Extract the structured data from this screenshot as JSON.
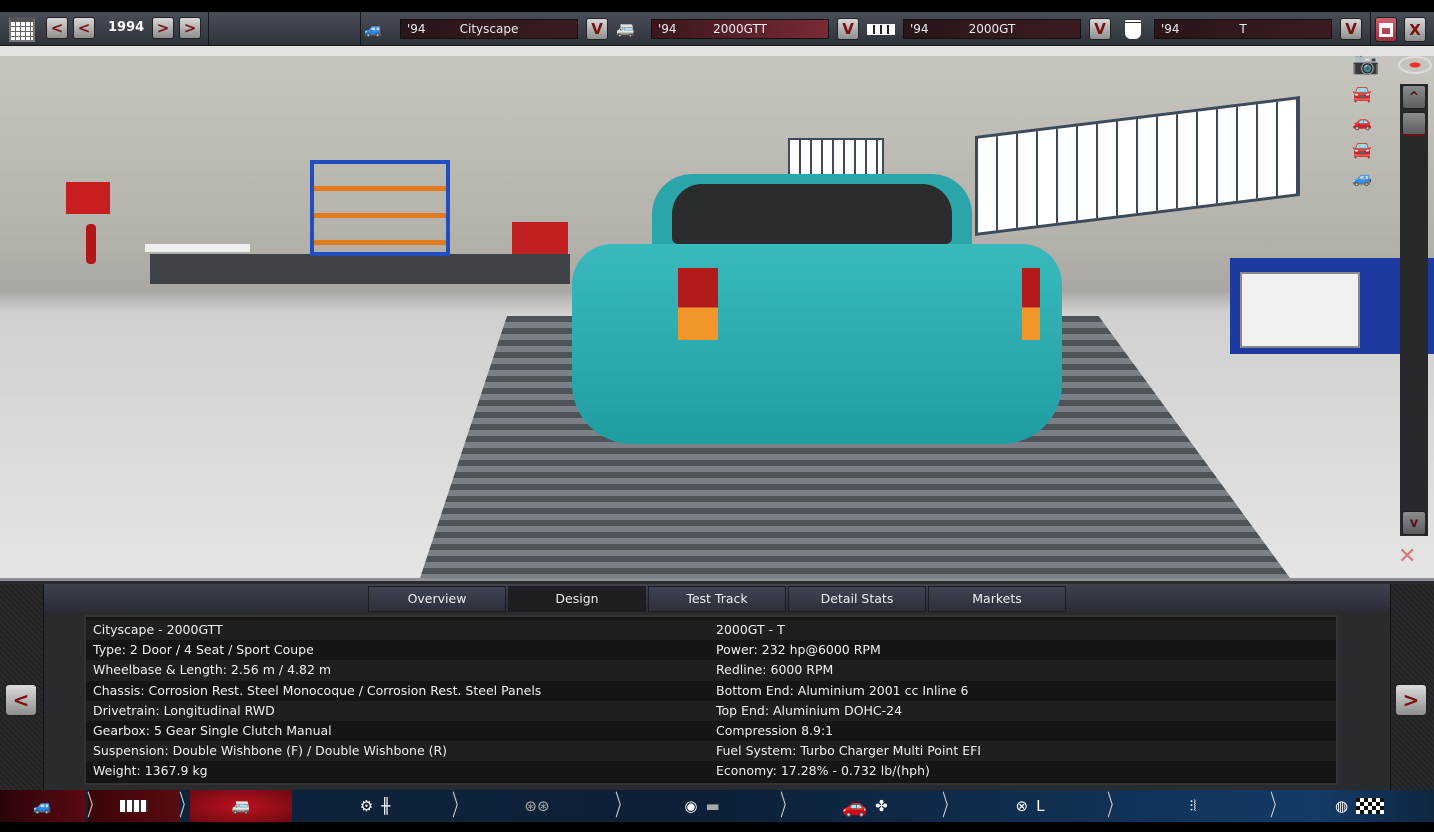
{
  "toolbar": {
    "year": "1994",
    "prev_label": "<",
    "next_label": ">",
    "selectors": [
      {
        "icon": "car-body-icon",
        "year": "'94",
        "name": "Cityscape",
        "dropdown": "V"
      },
      {
        "icon": "car-model-icon",
        "year": "'94",
        "name": "2000GTT",
        "dropdown": "V"
      },
      {
        "icon": "engine-block-icon",
        "year": "'94",
        "name": "2000GT",
        "dropdown": "V"
      },
      {
        "icon": "piston-icon",
        "year": "'94",
        "name": "T",
        "dropdown": "V"
      }
    ],
    "save_icon": "save-icon",
    "close_label": "X"
  },
  "viewport": {
    "scroll_up": "^",
    "scroll_down": "v"
  },
  "tabs": [
    "Overview",
    "Design",
    "Test Track",
    "Detail Stats",
    "Markets"
  ],
  "active_tab": "Design",
  "info": {
    "left": [
      "Cityscape - 2000GTT",
      "Type: 2 Door / 4 Seat / Sport Coupe",
      "Wheelbase & Length: 2.56 m / 4.82 m",
      "Chassis: Corrosion Rest. Steel Monocoque / Corrosion Rest. Steel Panels",
      "Drivetrain: Longitudinal RWD",
      "Gearbox: 5 Gear Single Clutch Manual",
      "Suspension: Double Wishbone (F) / Double Wishbone (R)",
      "Weight: 1367.9 kg"
    ],
    "right": [
      "2000GT - T",
      "Power: 232 hp@6000 RPM",
      "Redline: 6000 RPM",
      "Bottom End: Aluminium 2001 cc Inline 6",
      "Top End: Aluminium DOHC-24",
      "Compression 8.9:1",
      "Fuel System: Turbo Charger Multi Point EFI",
      "Economy: 17.28% - 0.732 lb/(hph)"
    ]
  },
  "pager": {
    "prev": "<",
    "next": ">"
  },
  "colors": {
    "accent": "#7a1010",
    "active_stage": "#b0101c",
    "nav_blue": "#0d2038",
    "car": "#2aa6ab"
  }
}
